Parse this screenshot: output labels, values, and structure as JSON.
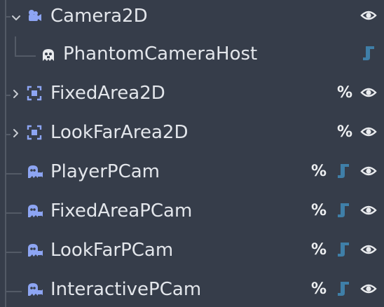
{
  "scene_tree": {
    "nodes": [
      {
        "label": "Camera2D",
        "icon": "camera2d-icon",
        "expandable": true,
        "expanded": true,
        "unique_name": false,
        "has_script": false,
        "visible": true
      },
      {
        "label": "PhantomCameraHost",
        "icon": "phantom-camera-host-icon",
        "expandable": false,
        "unique_name": false,
        "has_script": true,
        "visible": false
      },
      {
        "label": "FixedArea2D",
        "icon": "area2d-icon",
        "expandable": true,
        "expanded": false,
        "unique_name": true,
        "has_script": false,
        "visible": true
      },
      {
        "label": "LookFarArea2D",
        "icon": "area2d-icon",
        "expandable": true,
        "expanded": false,
        "unique_name": true,
        "has_script": false,
        "visible": true
      },
      {
        "label": "PlayerPCam",
        "icon": "phantom-camera-2d-icon",
        "expandable": false,
        "unique_name": true,
        "has_script": true,
        "visible": true
      },
      {
        "label": "FixedAreaPCam",
        "icon": "phantom-camera-2d-icon",
        "expandable": false,
        "unique_name": true,
        "has_script": true,
        "visible": true
      },
      {
        "label": "LookFarPCam",
        "icon": "phantom-camera-2d-icon",
        "expandable": false,
        "unique_name": true,
        "has_script": true,
        "visible": true
      },
      {
        "label": "InteractivePCam",
        "icon": "phantom-camera-2d-icon",
        "expandable": false,
        "unique_name": true,
        "has_script": true,
        "visible": true
      }
    ],
    "unique_name_symbol": "%"
  },
  "colors": {
    "background": "#363d4a",
    "text": "#e3e6eb",
    "node_icon": "#8da5f3",
    "script_icon": "#3f7fa8",
    "eye_icon": "#e8eaed",
    "guide_lines": "#535a66"
  }
}
